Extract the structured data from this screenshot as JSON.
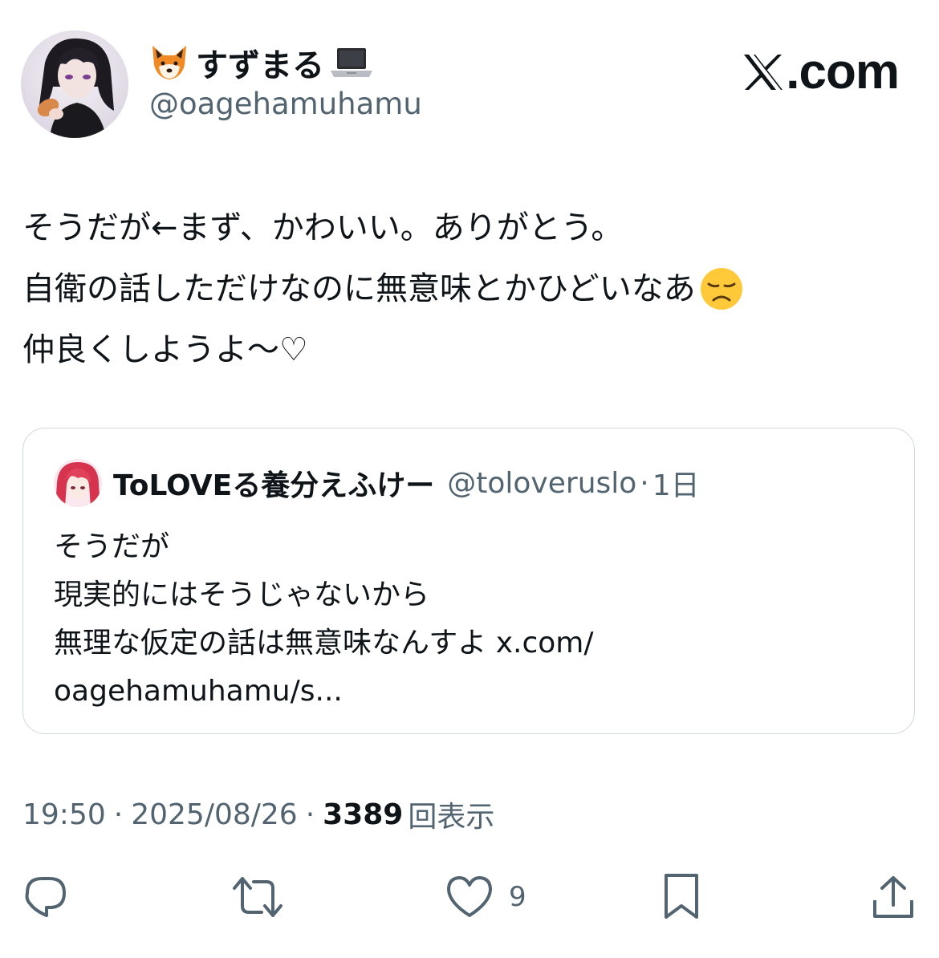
{
  "author": {
    "display_name": "すずまる",
    "name_prefix_icon": "fox-emoji",
    "name_suffix_icon": "laptop-emoji",
    "handle": "@oagehamuhamu",
    "avatar_icon": "profile-avatar"
  },
  "brand": {
    "logo_icon": "x-logo",
    "text": ".com"
  },
  "tweet": {
    "lines": [
      "そうだが←まず、かわいい。ありがとう。",
      "自衛の話しただけなのに無意味とかひどいなあ",
      "仲良くしようよ〜♡"
    ],
    "line2_emoji": "disappointed-face-emoji"
  },
  "quoted_tweet": {
    "display_name": "ToLOVEる養分えふけー",
    "handle": "@toloveruslo",
    "separator": "·",
    "time": "1日",
    "lines": [
      "そうだが",
      "現実的にはそうじゃないから",
      "無理な仮定の話は無意味なんすよ x.com/",
      "oagehamuhamu/s..."
    ]
  },
  "meta": {
    "time": "19:50",
    "separator": "·",
    "date": "2025/08/26",
    "views_count": "3389",
    "views_label": "回表示"
  },
  "actions": {
    "reply_icon": "reply-icon",
    "retweet_icon": "retweet-icon",
    "like_icon": "like-icon",
    "like_count": "9",
    "bookmark_icon": "bookmark-icon",
    "share_icon": "share-icon"
  },
  "colors": {
    "text_primary": "#0f1419",
    "text_secondary": "#536471",
    "border": "#cfd9de",
    "background": "#ffffff"
  }
}
